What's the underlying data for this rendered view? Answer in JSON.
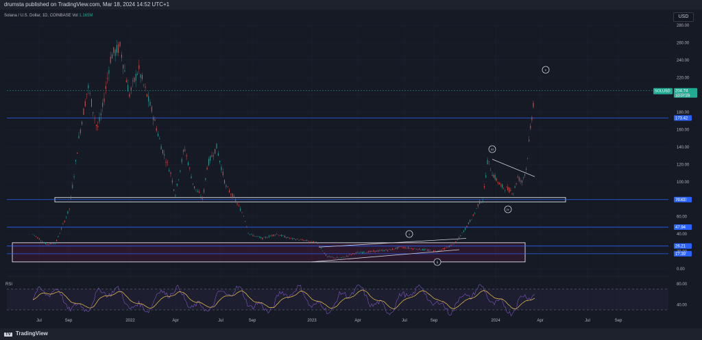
{
  "header": {
    "publish_text": "drumsta published on TradingView.com, Mar 18, 2024 14:52 UTC+1"
  },
  "legend": {
    "symbol_text": "Solana / U.S. Dollar, 1D, COINBASE",
    "vol_label": "Vol",
    "vol_value": "1.165M"
  },
  "currency_button": "USD",
  "rsi_label": "RSI",
  "brand": {
    "logo": "TV",
    "name": "TradingView"
  },
  "colors": {
    "up": "#26a69a",
    "down": "#ef5350",
    "hline": "#2962ff",
    "rsi": "#7e57c2",
    "rsi_ma": "#f7c948",
    "last_price": "#22ab94"
  },
  "tags": {
    "last_symbol": "SOLUSD",
    "last_price": "204.74",
    "countdown": "10:07:29"
  },
  "chart_data": {
    "type": "candlestick",
    "y_ticks": [
      "280.00",
      "260.00",
      "240.00",
      "220.00",
      "200.00",
      "180.00",
      "160.00",
      "140.00",
      "120.00",
      "100.00",
      "80.00",
      "60.00",
      "40.00",
      "20.00",
      "0.00"
    ],
    "x_ticks": [
      "Jul",
      "Sep",
      "2022",
      "Apr",
      "Jul",
      "Sep",
      "2023",
      "Apr",
      "Jul",
      "Sep",
      "2024",
      "Apr",
      "Jul",
      "Sep"
    ],
    "price_lines": [
      {
        "price": 173.42,
        "label": "173.42"
      },
      {
        "price": 79.63,
        "label": "79.63"
      },
      {
        "price": 47.94,
        "label": "47.94"
      },
      {
        "price": 26.21,
        "label": "26.21"
      },
      {
        "price": 17.39,
        "label": "17.39"
      }
    ],
    "price_path": [
      [
        0,
        40
      ],
      [
        0.03,
        28
      ],
      [
        0.05,
        30
      ],
      [
        0.08,
        70
      ],
      [
        0.1,
        150
      ],
      [
        0.12,
        210
      ],
      [
        0.14,
        160
      ],
      [
        0.15,
        180
      ],
      [
        0.17,
        245
      ],
      [
        0.19,
        255
      ],
      [
        0.21,
        200
      ],
      [
        0.23,
        230
      ],
      [
        0.26,
        180
      ],
      [
        0.28,
        140
      ],
      [
        0.3,
        110
      ],
      [
        0.31,
        85
      ],
      [
        0.33,
        140
      ],
      [
        0.35,
        95
      ],
      [
        0.37,
        80
      ],
      [
        0.38,
        120
      ],
      [
        0.4,
        140
      ],
      [
        0.42,
        95
      ],
      [
        0.44,
        80
      ],
      [
        0.46,
        60
      ],
      [
        0.47,
        40
      ],
      [
        0.5,
        35
      ],
      [
        0.53,
        40
      ],
      [
        0.56,
        35
      ],
      [
        0.6,
        32
      ],
      [
        0.62,
        30
      ],
      [
        0.64,
        14
      ],
      [
        0.67,
        12
      ],
      [
        0.7,
        18
      ],
      [
        0.74,
        20
      ],
      [
        0.78,
        22
      ],
      [
        0.8,
        25
      ],
      [
        0.85,
        22
      ],
      [
        0.88,
        20
      ],
      [
        0.9,
        24
      ],
      [
        0.92,
        30
      ],
      [
        0.94,
        45
      ],
      [
        0.96,
        62
      ],
      [
        0.97,
        75
      ],
      [
        0.98,
        80
      ],
      [
        0.99,
        125
      ],
      [
        1.0,
        110
      ]
    ],
    "price_path_tail": [
      [
        0,
        110
      ],
      [
        0.2,
        95
      ],
      [
        0.35,
        92
      ],
      [
        0.5,
        88
      ],
      [
        0.6,
        105
      ],
      [
        0.7,
        100
      ],
      [
        0.8,
        115
      ],
      [
        0.9,
        160
      ],
      [
        1.0,
        205
      ]
    ],
    "zones": [
      {
        "label": "resistance-zone",
        "low": 77,
        "high": 82
      },
      {
        "label": "support-zone",
        "low": 8,
        "high": 30
      }
    ],
    "wave_labels": [
      "i",
      "ii",
      "iii",
      "iv",
      "v"
    ],
    "rsi_ticks": [
      "80.00",
      "40.00"
    ],
    "rsi_levels": [
      70,
      30
    ]
  }
}
